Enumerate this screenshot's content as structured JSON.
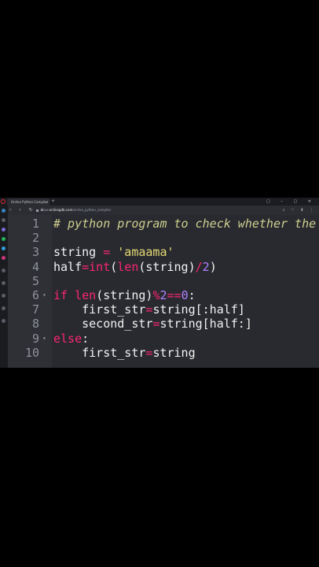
{
  "browser": {
    "tab_title": "Online Python Compiler",
    "tab_close": "×",
    "new_tab": "+",
    "window_controls": "▢ – ▢ ✕",
    "nav_buttons": "‹ › ↻ ⌂",
    "url_prefix": "www.",
    "url_domain": "onlinegdb.com",
    "url_path": "/online_python_compiler",
    "nav_right_icons": "⌕ ♡ ⬇ ⋮"
  },
  "colors": {
    "comment": "#cfcf8f",
    "string": "#e6db74",
    "keyword": "#f92672",
    "number": "#ae81ff",
    "text": "#f2f2f2",
    "editor_bg": "#292a30",
    "gutter_bg": "#2f3036"
  },
  "editor": {
    "lines": [
      {
        "num": "1",
        "fold": "",
        "segments": [
          {
            "t": "cm",
            "v": "# python program to check whether the s"
          }
        ]
      },
      {
        "num": "2",
        "fold": "",
        "segments": []
      },
      {
        "num": "3",
        "fold": "",
        "segments": [
          {
            "t": "nm",
            "v": "string "
          },
          {
            "t": "op",
            "v": "="
          },
          {
            "t": "nm",
            "v": " "
          },
          {
            "t": "str",
            "v": "'amaama'"
          }
        ]
      },
      {
        "num": "4",
        "fold": "",
        "segments": [
          {
            "t": "nm",
            "v": "half"
          },
          {
            "t": "op",
            "v": "="
          },
          {
            "t": "fn",
            "v": "int"
          },
          {
            "t": "nm",
            "v": "("
          },
          {
            "t": "fn",
            "v": "len"
          },
          {
            "t": "nm",
            "v": "(string)"
          },
          {
            "t": "op",
            "v": "/"
          },
          {
            "t": "num",
            "v": "2"
          },
          {
            "t": "nm",
            "v": ")"
          }
        ]
      },
      {
        "num": "5",
        "fold": "",
        "segments": []
      },
      {
        "num": "6",
        "fold": "▾",
        "segments": [
          {
            "t": "kw",
            "v": "if"
          },
          {
            "t": "nm",
            "v": " "
          },
          {
            "t": "fn",
            "v": "len"
          },
          {
            "t": "nm",
            "v": "(string)"
          },
          {
            "t": "op",
            "v": "%"
          },
          {
            "t": "num",
            "v": "2"
          },
          {
            "t": "op",
            "v": "=="
          },
          {
            "t": "num",
            "v": "0"
          },
          {
            "t": "nm",
            "v": ":"
          }
        ]
      },
      {
        "num": "7",
        "fold": "",
        "segments": [
          {
            "t": "nm",
            "v": "    first_str"
          },
          {
            "t": "op",
            "v": "="
          },
          {
            "t": "nm",
            "v": "string[:half]"
          }
        ]
      },
      {
        "num": "8",
        "fold": "",
        "segments": [
          {
            "t": "nm",
            "v": "    second_str"
          },
          {
            "t": "op",
            "v": "="
          },
          {
            "t": "nm",
            "v": "string[half:]"
          }
        ]
      },
      {
        "num": "9",
        "fold": "▾",
        "segments": [
          {
            "t": "kw",
            "v": "else"
          },
          {
            "t": "nm",
            "v": ":"
          }
        ]
      },
      {
        "num": "10",
        "fold": "",
        "segments": [
          {
            "t": "nm",
            "v": "    first_str"
          },
          {
            "t": "op",
            "v": "="
          },
          {
            "t": "nm",
            "v": "string"
          }
        ]
      }
    ]
  }
}
